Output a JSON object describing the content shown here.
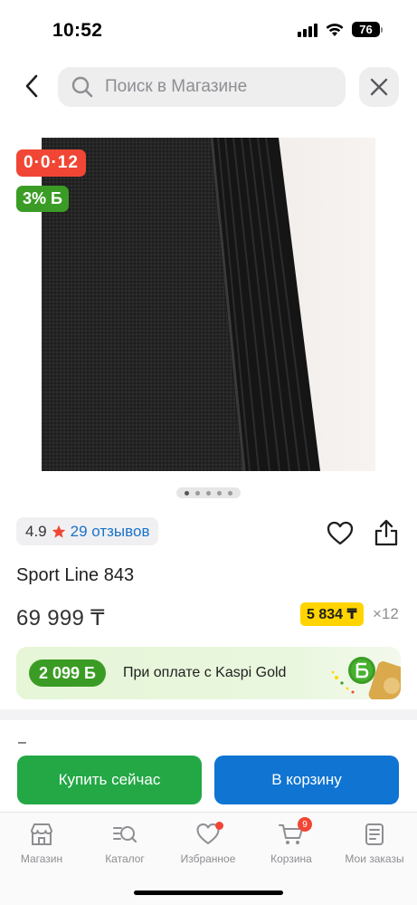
{
  "status_bar": {
    "time": "10:52",
    "battery": "76"
  },
  "search": {
    "placeholder": "Поиск в Магазине"
  },
  "badges": {
    "promo": "0·0·12",
    "bonus_percent": "3% Б"
  },
  "product": {
    "rating": "4.9",
    "reviews": "29 отзывов",
    "title": "Sport Line 843",
    "price": "69 999 ₸",
    "installment_amount": "5 834 ₸",
    "installment_months": "×12"
  },
  "kaspi_gold": {
    "bonus": "2 099 Б",
    "text": "При оплате с Kaspi Gold"
  },
  "dash": "–",
  "actions": {
    "buy_now": "Купить сейчас",
    "add_to_cart": "В корзину"
  },
  "tab_bar": {
    "items": [
      {
        "label": "Магазин",
        "icon": "store-icon"
      },
      {
        "label": "Каталог",
        "icon": "catalog-search-icon"
      },
      {
        "label": "Избранное",
        "icon": "heart-icon"
      },
      {
        "label": "Корзина",
        "icon": "cart-icon"
      },
      {
        "label": "Мои заказы",
        "icon": "orders-icon"
      }
    ],
    "cart_count": "9"
  },
  "colors": {
    "promo_red": "#f14635",
    "bonus_green": "#3b9c25",
    "buy_green": "#23a845",
    "cart_blue": "#0f74d2",
    "installment_yellow": "#ffd400",
    "link_blue": "#1a73c9"
  }
}
